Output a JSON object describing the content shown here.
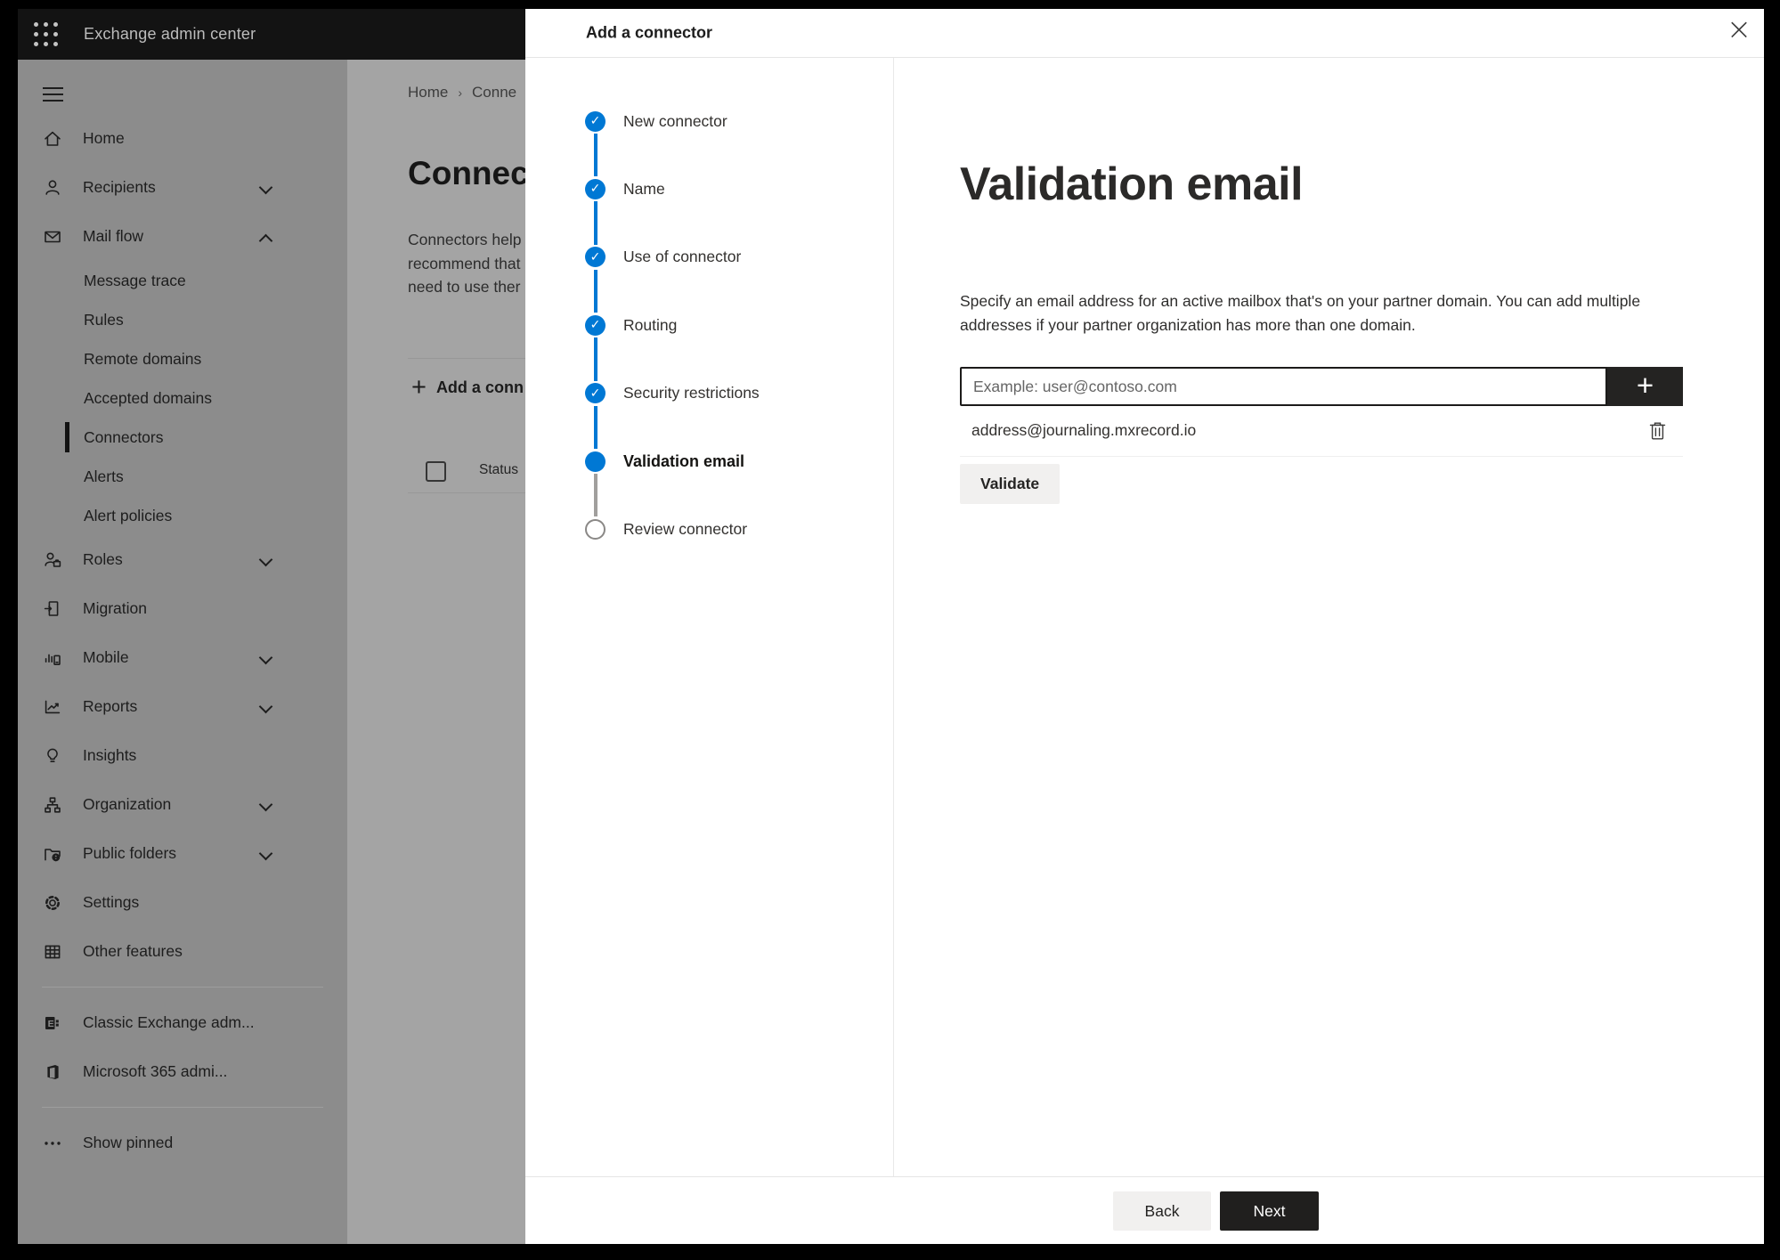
{
  "topbar": {
    "title": "Exchange admin center",
    "waffle_icon": "app-launcher-icon"
  },
  "sidebar": {
    "items": [
      {
        "label": "Home",
        "icon": "home-icon",
        "level": 1
      },
      {
        "label": "Recipients",
        "icon": "person-icon",
        "level": 1,
        "chevron": "down"
      },
      {
        "label": "Mail flow",
        "icon": "mail-icon",
        "level": 1,
        "chevron": "up"
      },
      {
        "label": "Message trace",
        "level": 2
      },
      {
        "label": "Rules",
        "level": 2
      },
      {
        "label": "Remote domains",
        "level": 2
      },
      {
        "label": "Accepted domains",
        "level": 2
      },
      {
        "label": "Connectors",
        "level": 2,
        "selected": true
      },
      {
        "label": "Alerts",
        "level": 2
      },
      {
        "label": "Alert policies",
        "level": 2
      },
      {
        "label": "Roles",
        "icon": "roles-icon",
        "level": 1,
        "chevron": "down"
      },
      {
        "label": "Migration",
        "icon": "migration-icon",
        "level": 1
      },
      {
        "label": "Mobile",
        "icon": "mobile-icon",
        "level": 1,
        "chevron": "down"
      },
      {
        "label": "Reports",
        "icon": "reports-icon",
        "level": 1,
        "chevron": "down"
      },
      {
        "label": "Insights",
        "icon": "lightbulb-icon",
        "level": 1
      },
      {
        "label": "Organization",
        "icon": "org-chart-icon",
        "level": 1,
        "chevron": "down"
      },
      {
        "label": "Public folders",
        "icon": "folder-globe-icon",
        "level": 1,
        "chevron": "down"
      },
      {
        "label": "Settings",
        "icon": "gear-icon",
        "level": 1
      },
      {
        "label": "Other features",
        "icon": "table-grid-icon",
        "level": 1
      },
      {
        "type": "divider"
      },
      {
        "label": "Classic Exchange adm...",
        "icon": "exchange-logo-icon",
        "level": 1
      },
      {
        "label": "Microsoft 365 admi...",
        "icon": "office-logo-icon",
        "level": 1
      },
      {
        "type": "divider"
      },
      {
        "label": "Show pinned",
        "icon": "ellipsis-icon",
        "level": 1
      }
    ]
  },
  "page": {
    "breadcrumb": [
      "Home",
      "Conne"
    ],
    "title": "Connec",
    "description_lines": [
      "Connectors help",
      "recommend that",
      "need to use ther"
    ],
    "add_button_label": "Add a conn",
    "table": {
      "columns": [
        "Status"
      ]
    }
  },
  "modal": {
    "title": "Add a connector",
    "close_icon": "close-icon",
    "steps": [
      {
        "label": "New connector",
        "state": "complete"
      },
      {
        "label": "Name",
        "state": "complete"
      },
      {
        "label": "Use of connector",
        "state": "complete"
      },
      {
        "label": "Routing",
        "state": "complete"
      },
      {
        "label": "Security restrictions",
        "state": "complete"
      },
      {
        "label": "Validation email",
        "state": "current"
      },
      {
        "label": "Review connector",
        "state": "upcoming"
      }
    ],
    "content": {
      "heading": "Validation email",
      "description": "Specify an email address for an active mailbox that's on your partner domain. You can add multiple addresses if your partner organization has more than one domain.",
      "email_input": {
        "value": "",
        "placeholder": "Example: user@contoso.com"
      },
      "add_address_icon": "plus-icon",
      "addresses": [
        {
          "email": "address@journaling.mxrecord.io",
          "delete_icon": "trash-icon"
        }
      ],
      "validate_button_label": "Validate"
    },
    "footer": {
      "back_label": "Back",
      "next_label": "Next"
    }
  },
  "colors": {
    "accent_blue": "#0078d4",
    "panel_bg": "#ffffff",
    "topbar_bg": "#131313",
    "primary_button": "#201f1e"
  }
}
